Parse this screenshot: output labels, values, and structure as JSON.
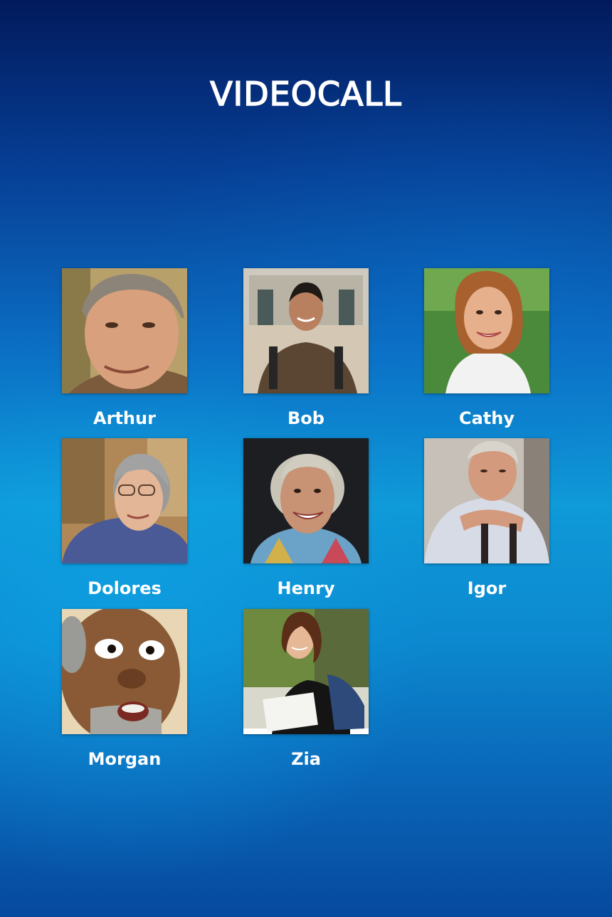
{
  "screen": {
    "title": "VIDEOCALL"
  },
  "contacts": [
    {
      "name": "Arthur",
      "avatar": "avatar-arthur"
    },
    {
      "name": "Bob",
      "avatar": "avatar-bob"
    },
    {
      "name": "Cathy",
      "avatar": "avatar-cathy"
    },
    {
      "name": "Dolores",
      "avatar": "avatar-dolores"
    },
    {
      "name": "Henry",
      "avatar": "avatar-henry"
    },
    {
      "name": "Igor",
      "avatar": "avatar-igor"
    },
    {
      "name": "Morgan",
      "avatar": "avatar-morgan"
    },
    {
      "name": "Zia",
      "avatar": "avatar-zia"
    }
  ],
  "colors": {
    "background_top": "#021a5c",
    "background_mid": "#0f9ad9",
    "text": "#ffffff"
  }
}
